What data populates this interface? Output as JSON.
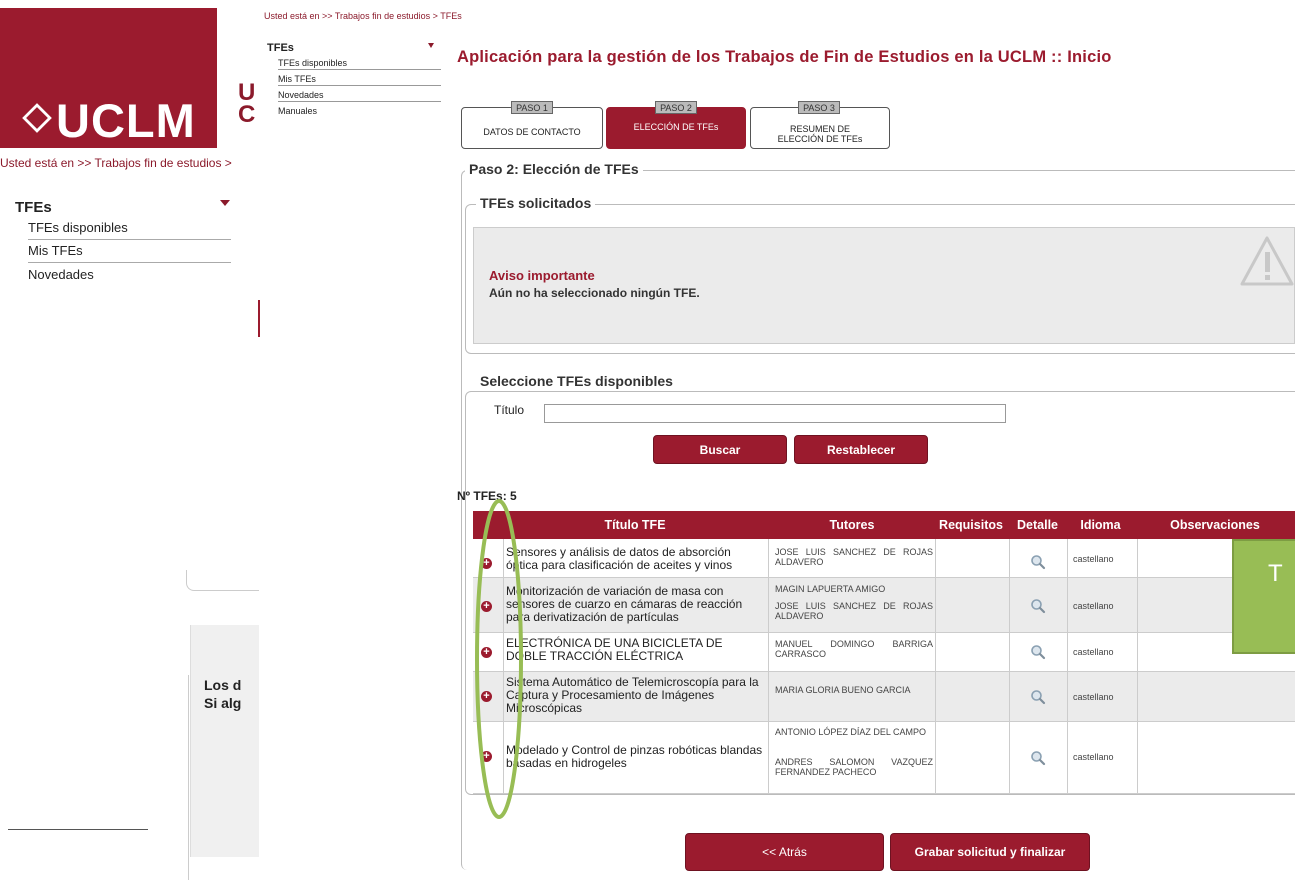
{
  "background_page": {
    "logo_text": "UCLM",
    "uni_part_line1": "U",
    "uni_part_line2": "C",
    "breadcrumb": "Usted está en >> Trabajos fin de estudios >",
    "menu_title": "TFEs",
    "menu_items": [
      "TFEs disponibles",
      "Mis TFEs",
      "Novedades"
    ],
    "box_line1": "Los d",
    "box_line2": "Si alg"
  },
  "breadcrumb": "Usted está en >> Trabajos fin de estudios > TFEs",
  "sidebar": {
    "title": "TFEs",
    "items": [
      "TFEs disponibles",
      "Mis TFEs",
      "Novedades",
      "Manuales"
    ]
  },
  "page_title": "Aplicación para la gestión de los Trabajos de Fin de Estudios en la UCLM :: Inicio",
  "steps": [
    {
      "tag": "PASO 1",
      "label": "DATOS DE CONTACTO"
    },
    {
      "tag": "PASO 2",
      "label": "ELECCIÓN DE TFEs"
    },
    {
      "tag": "PASO 3",
      "label": "RESUMEN DE ELECCIÓN DE TFEs"
    }
  ],
  "section_main": "Paso 2: Elección de TFEs",
  "section_requested": "TFEs solicitados",
  "warning": {
    "title": "Aviso importante",
    "text": "Aún no ha seleccionado ningún TFE."
  },
  "section_available": "Seleccione TFEs disponibles",
  "search": {
    "label": "Título",
    "value": "",
    "search_button": "Buscar",
    "reset_button": "Restablecer"
  },
  "count_label": "Nº TFEs: 5",
  "table": {
    "headers": [
      "Título TFE",
      "Tutores",
      "Requisitos",
      "Detalle",
      "Idioma",
      "Observaciones"
    ],
    "rows": [
      {
        "title": "Sensores y análisis de datos de absorción óptica para clasificación de aceites y vinos",
        "tutors": [
          "JOSE LUIS SANCHEZ DE ROJAS ALDAVERO"
        ],
        "requisitos": "",
        "idioma": "castellano",
        "observaciones": ""
      },
      {
        "title": "Monitorización de variación de masa con sensores de cuarzo en cámaras de reacción para derivatización de partículas",
        "tutors": [
          "MAGIN LAPUERTA AMIGO",
          "JOSE LUIS SANCHEZ DE ROJAS ALDAVERO"
        ],
        "requisitos": "",
        "idioma": "castellano",
        "observaciones": ""
      },
      {
        "title": "ELECTRÓNICA DE UNA BICICLETA DE DOBLE TRACCIÓN ELÉCTRICA",
        "tutors": [
          "MANUEL DOMINGO BARRIGA CARRASCO"
        ],
        "requisitos": "",
        "idioma": "castellano",
        "observaciones": ""
      },
      {
        "title": "Sistema Automático de Telemicroscopía para la Captura y Procesamiento de Imágenes Microscópicas",
        "tutors": [
          "MARIA GLORIA BUENO GARCIA"
        ],
        "requisitos": "",
        "idioma": "castellano",
        "observaciones": ""
      },
      {
        "title": "Modelado y Control de pinzas robóticas blandas basadas en hidrogeles",
        "tutors": [
          "ANTONIO LÓPEZ DÍAZ DEL CAMPO",
          "ANDRES SALOMON VAZQUEZ FERNANDEZ PACHECO"
        ],
        "requisitos": "",
        "idioma": "castellano",
        "observaciones": ""
      }
    ]
  },
  "footer_buttons": {
    "back": "<< Atrás",
    "save": "Grabar solicitud y finalizar"
  },
  "callout_text": "T",
  "colors": {
    "brand": "#9b1b2e",
    "annotation_green": "#98bd55"
  },
  "icons": {
    "add": "plus-circle-icon",
    "detail": "magnifier-icon",
    "warning": "warning-triangle-icon",
    "menu_caret": "caret-down-icon"
  }
}
